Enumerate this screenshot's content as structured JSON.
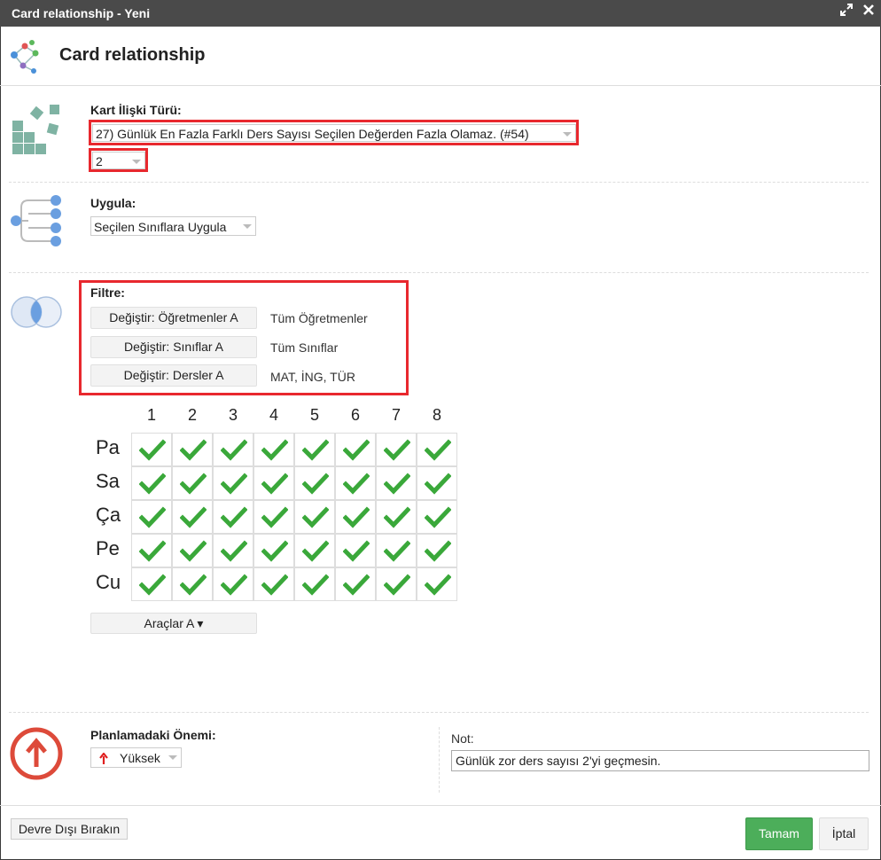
{
  "window": {
    "title": "Card relationship - Yeni"
  },
  "header": {
    "title": "Card relationship"
  },
  "relation_type": {
    "label": "Kart İlişki Türü:",
    "selected": "27) Günlük En Fazla Farklı Ders Sayısı Seçilen Değerden Fazla Olamaz. (#54)",
    "value": "2"
  },
  "apply": {
    "label": "Uygula:",
    "selected": "Seçilen Sınıflara Uygula"
  },
  "filter": {
    "label": "Filtre:",
    "rows": [
      {
        "button": "Değiştir: Öğretmenler A",
        "value": "Tüm Öğretmenler"
      },
      {
        "button": "Değiştir: Sınıflar A",
        "value": "Tüm Sınıflar"
      },
      {
        "button": "Değiştir: Dersler A",
        "value": "MAT, İNG, TÜR"
      }
    ]
  },
  "grid": {
    "columns": [
      "1",
      "2",
      "3",
      "4",
      "5",
      "6",
      "7",
      "8"
    ],
    "rows": [
      "Pa",
      "Sa",
      "Ça",
      "Pe",
      "Cu"
    ],
    "check_color": "#3aa83a"
  },
  "tools": {
    "label": "Araçlar A ▾"
  },
  "importance": {
    "label": "Planlamadaki Önemi:",
    "selected": "Yüksek"
  },
  "note": {
    "label": "Not:",
    "value": "Günlük zor ders sayısı 2'yi geçmesin."
  },
  "footer": {
    "disable_label": "Devre Dışı Bırakın",
    "ok_label": "Tamam",
    "cancel_label": "İptal"
  },
  "colors": {
    "titlebar": "#4a4a4a",
    "highlight": "#e8282e",
    "ok": "#4cae5a"
  }
}
